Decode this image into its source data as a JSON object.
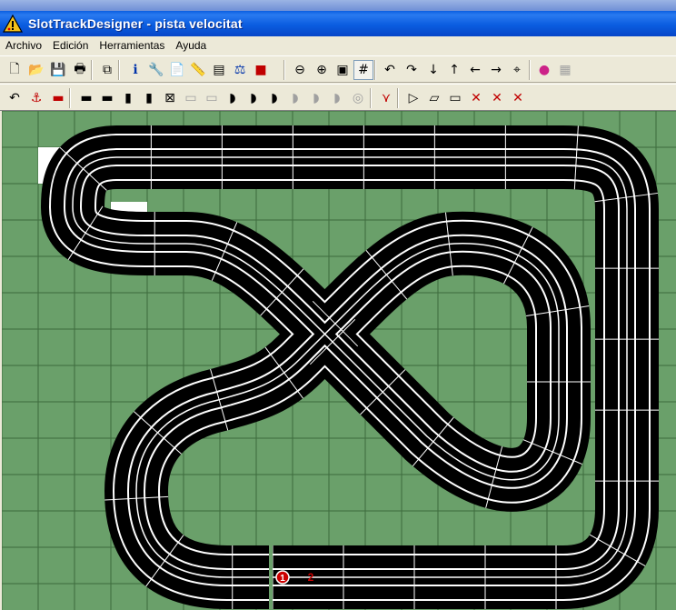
{
  "window": {
    "title": "SlotTrackDesigner - pista velocitat"
  },
  "menu": {
    "items": [
      "Archivo",
      "Edición",
      "Herramientas",
      "Ayuda"
    ]
  },
  "toolbar1": {
    "buttons": [
      {
        "name": "new-file-icon",
        "glyph": "🗋"
      },
      {
        "name": "open-folder-icon",
        "glyph": "📂"
      },
      {
        "name": "save-icon",
        "glyph": "💾"
      },
      {
        "name": "print-icon",
        "glyph": "🖶"
      },
      {
        "name": "copy-icon",
        "glyph": "⧉"
      },
      {
        "name": "info-icon",
        "glyph": "ℹ"
      },
      {
        "name": "wrench-icon",
        "glyph": "🔧"
      },
      {
        "name": "document-icon",
        "glyph": "📄"
      },
      {
        "name": "ruler-icon",
        "glyph": "📏"
      },
      {
        "name": "toolbox-icon",
        "glyph": "▤"
      },
      {
        "name": "scale-icon",
        "glyph": "⚖"
      },
      {
        "name": "color-icon",
        "glyph": "■"
      },
      {
        "name": "zoom-out-icon",
        "glyph": "⊖"
      },
      {
        "name": "zoom-in-icon",
        "glyph": "⊕"
      },
      {
        "name": "fit-page-icon",
        "glyph": "▣"
      },
      {
        "name": "grid-icon",
        "glyph": "#"
      },
      {
        "name": "rotate-left-icon",
        "glyph": "↶"
      },
      {
        "name": "rotate-right-icon",
        "glyph": "↷"
      },
      {
        "name": "arrow-down-icon",
        "glyph": "↓"
      },
      {
        "name": "arrow-up-icon",
        "glyph": "↑"
      },
      {
        "name": "arrow-left-icon",
        "glyph": "←"
      },
      {
        "name": "arrow-right-icon",
        "glyph": "→"
      },
      {
        "name": "center-icon",
        "glyph": "⌖"
      },
      {
        "name": "palette-icon",
        "glyph": "●"
      },
      {
        "name": "properties-icon",
        "glyph": "▦"
      }
    ]
  },
  "toolbar2": {
    "buttons": [
      {
        "name": "undo-icon",
        "glyph": "↶"
      },
      {
        "name": "anchor-icon",
        "glyph": "⚓"
      },
      {
        "name": "track-red-icon",
        "glyph": "▬"
      },
      {
        "name": "straight-track-icon",
        "glyph": "▬"
      },
      {
        "name": "straight-long-icon",
        "glyph": "▬"
      },
      {
        "name": "straight-short-icon",
        "glyph": "▮"
      },
      {
        "name": "straight-half-icon",
        "glyph": "▮"
      },
      {
        "name": "crossover-icon",
        "glyph": "⊠"
      },
      {
        "name": "track-disabled-1-icon",
        "glyph": "▭"
      },
      {
        "name": "track-disabled-2-icon",
        "glyph": "▭"
      },
      {
        "name": "curve-1-icon",
        "glyph": "◗"
      },
      {
        "name": "curve-2-icon",
        "glyph": "◗"
      },
      {
        "name": "curve-3-icon",
        "glyph": "◗"
      },
      {
        "name": "curve-disabled-1-icon",
        "glyph": "◗"
      },
      {
        "name": "curve-disabled-2-icon",
        "glyph": "◗"
      },
      {
        "name": "curve-disabled-3-icon",
        "glyph": "◗"
      },
      {
        "name": "curve-disabled-4-icon",
        "glyph": "◎"
      },
      {
        "name": "junction-icon",
        "glyph": "⋎"
      },
      {
        "name": "piece-a-icon",
        "glyph": "▷"
      },
      {
        "name": "piece-b-icon",
        "glyph": "▱"
      },
      {
        "name": "piece-c-icon",
        "glyph": "▭"
      },
      {
        "name": "delete-1-icon",
        "glyph": "✕"
      },
      {
        "name": "delete-2-icon",
        "glyph": "✕"
      },
      {
        "name": "delete-3-icon",
        "glyph": "✕"
      }
    ]
  },
  "track": {
    "marker1": "1",
    "marker2": "2",
    "colors": {
      "canvas_bg": "#6aa06a",
      "grid_line": "#3c6a3c",
      "asphalt": "#000000",
      "lane_line": "#ffffff",
      "marker": "#cc0000"
    }
  }
}
